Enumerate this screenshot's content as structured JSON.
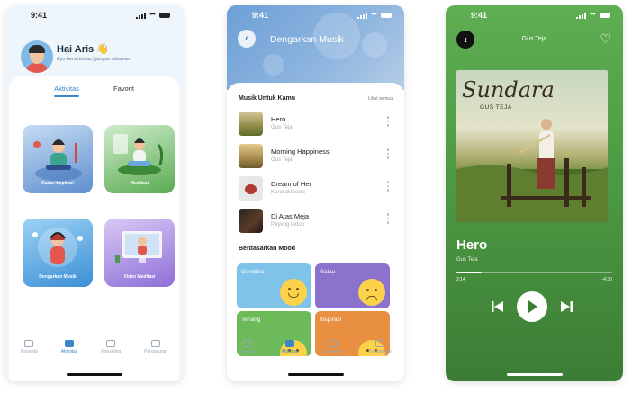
{
  "status": {
    "time": "9:41"
  },
  "screen_activity": {
    "greeting": "Hai Aris",
    "subtitle": "Ayo beraktivitas | jangan rebahan",
    "tabs": [
      "Aktivitas",
      "Favorit"
    ],
    "active_tab": "Aktivitas",
    "tiles": [
      "Kamu Inspirasi",
      "Meditasi",
      "Dengarkan Musik",
      "Video Meditasi"
    ],
    "nav": [
      "Beranda",
      "Aktivitas",
      "Konseling",
      "Pengaturan"
    ],
    "active_nav": "Aktivitas",
    "accent_color": "#3a86c8"
  },
  "screen_music": {
    "title": "Dengarkan Musik",
    "section_music": "Musik Untuk Kamu",
    "see_all": "Lihat semua",
    "songs": [
      {
        "title": "Hero",
        "artist": "Gus Teja"
      },
      {
        "title": "Morning Happiness",
        "artist": "Gus Teja"
      },
      {
        "title": "Dream of Her",
        "artist": "Kurosakibeats"
      },
      {
        "title": "Di Atas Meja",
        "artist": "Payung teduh"
      }
    ],
    "section_mood": "Berdasarkan Mood",
    "moods": [
      "Gembira",
      "Galau",
      "Tenang",
      "Inspirasi"
    ],
    "nav": [
      "Beranda",
      "Aktivitas",
      "Konseling",
      "Pengaturan"
    ],
    "active_nav": "Aktivitas"
  },
  "screen_player": {
    "header_artist": "Gus Teja",
    "cover_title": "Sundara",
    "cover_artist": "GUS TEJA",
    "track_title": "Hero",
    "track_artist": "Gus Teja",
    "time_current": "2:14",
    "time_remaining": "-4:30",
    "progress_fraction": 0.16,
    "theme_color": "#4d9a44"
  }
}
